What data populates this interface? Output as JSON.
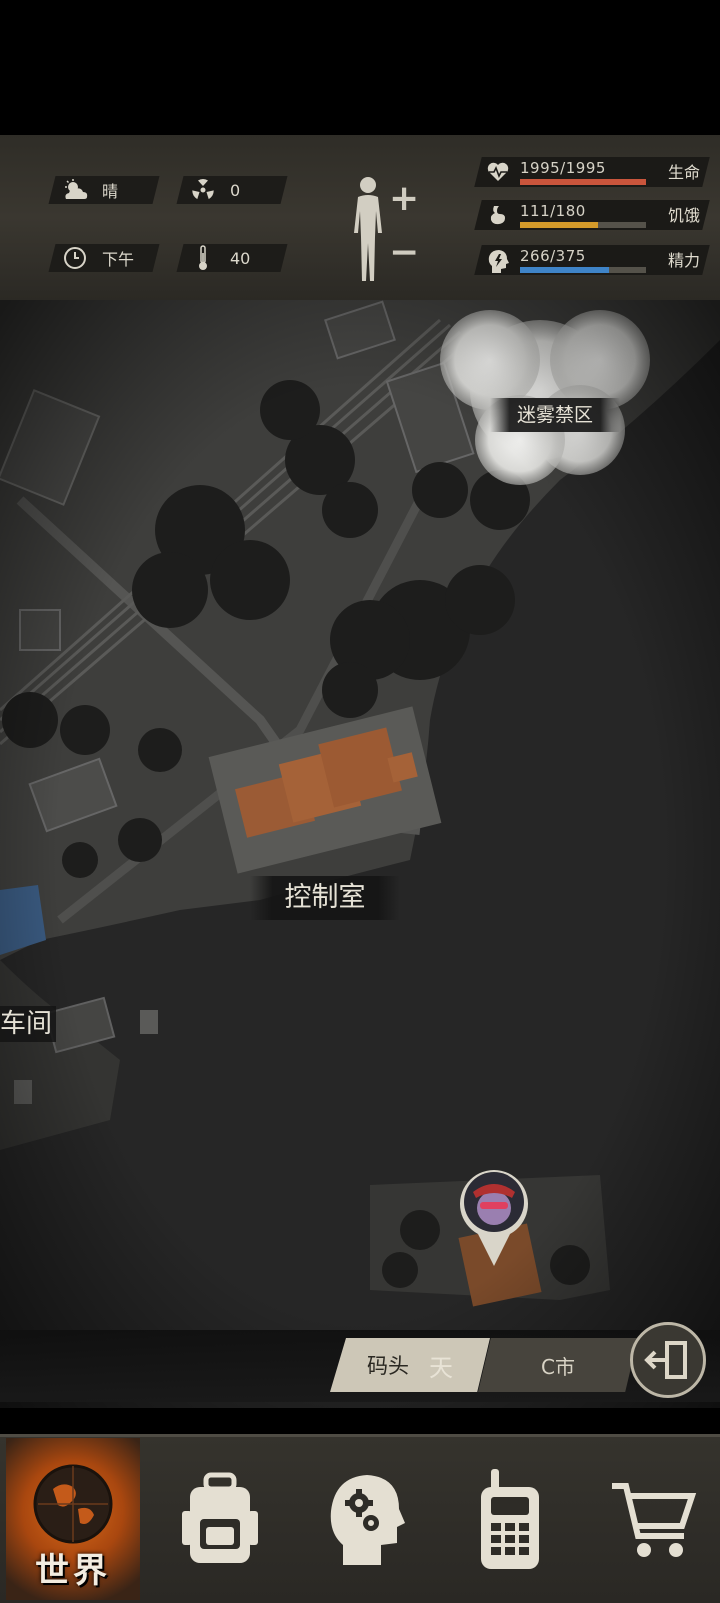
{
  "status": {
    "weather": "晴",
    "radiation": "0",
    "time_of_day": "下午",
    "temperature": "40",
    "stats": [
      {
        "value": "1995/1995",
        "name": "生命",
        "fraction": 1.0,
        "color": "#c9553c",
        "icon": "heart-pulse-icon"
      },
      {
        "value": "111/180",
        "name": "饥饿",
        "fraction": 0.617,
        "color": "#d49a2a",
        "icon": "stomach-icon"
      },
      {
        "value": "266/375",
        "name": "精力",
        "fraction": 0.709,
        "color": "#3f84c8",
        "icon": "head-energy-icon"
      }
    ]
  },
  "map": {
    "fog_zone_label": "迷雾禁区",
    "control_room_label": "控制室",
    "workshop_label": "车间"
  },
  "breadcrumb": {
    "current": "码头",
    "parent": "C市",
    "faded": "天"
  },
  "tabs": {
    "world_label": "世界"
  }
}
